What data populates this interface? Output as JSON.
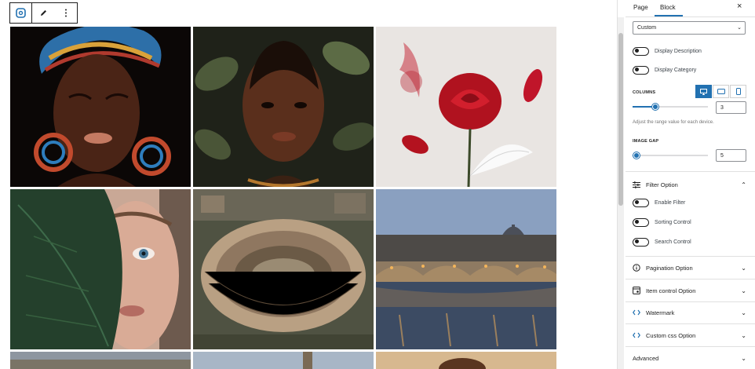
{
  "toolbar": {
    "buttons": [
      "gallery-block-icon",
      "pencil-icon",
      "more-options-icon"
    ]
  },
  "gallery": {
    "tiles": [
      {
        "subject": "woman-headwrap"
      },
      {
        "subject": "woman-leaves"
      },
      {
        "subject": "red-rose"
      },
      {
        "subject": "face-leaf"
      },
      {
        "subject": "colosseum"
      },
      {
        "subject": "rome-bridge"
      },
      {
        "subject": "city-partial"
      },
      {
        "subject": "dome-partial"
      },
      {
        "subject": "food-partial"
      }
    ]
  },
  "sidebar": {
    "tabs": {
      "page": "Page",
      "block": "Block"
    },
    "close": "×",
    "layout_select": {
      "value": "Custom"
    },
    "toggles": [
      {
        "label": "Display Description"
      },
      {
        "label": "Display Category"
      }
    ],
    "columns": {
      "label": "COLUMNS",
      "value": "3",
      "level": 0.3
    },
    "help_text": "Adjust the range value for each device.",
    "image_gap": {
      "label": "IMAGE GAP",
      "value": "5",
      "level": 0.05
    },
    "filter_option": {
      "title": "Filter Option",
      "toggles": [
        {
          "label": "Enable Filter"
        },
        {
          "label": "Sorting Control"
        },
        {
          "label": "Search Control"
        }
      ]
    },
    "panels": [
      {
        "title": "Pagination Option",
        "icon": "info-icon"
      },
      {
        "title": "Item control Option",
        "icon": "window-icon"
      },
      {
        "title": "Watermark",
        "icon": "code-icon"
      },
      {
        "title": "Custom css Option",
        "icon": "code-icon"
      },
      {
        "title": "Advanced",
        "icon": ""
      }
    ],
    "accent_color": "#2271b1"
  }
}
